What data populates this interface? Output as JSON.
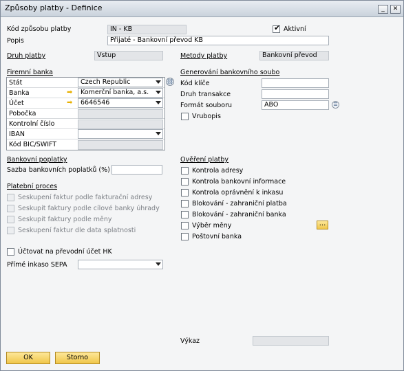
{
  "window": {
    "title": "Způsoby platby - Definice",
    "minimize": "_",
    "restore": "□",
    "close": "✕"
  },
  "header": {
    "code_label": "Kód způsobu platby",
    "code_value": "IN - KB",
    "active_label": "Aktivní",
    "active_checked": true,
    "desc_label": "Popis",
    "desc_value": "Přijaté - Bankovní převod KB"
  },
  "left": {
    "payment_type_label": "Druh platby",
    "payment_type_value": "Vstup",
    "company_bank_section": "Firemní banka",
    "grid": [
      {
        "label": "Stát",
        "value": "Czech Republic",
        "kind": "combo"
      },
      {
        "label": "Banka",
        "value": "Komerční banka, a.s.",
        "kind": "combo",
        "arrow": true
      },
      {
        "label": "Účet",
        "value": "6646546",
        "kind": "combo",
        "arrow": true
      },
      {
        "label": "Pobočka",
        "value": "",
        "kind": "ro"
      },
      {
        "label": "Kontrolní číslo",
        "value": "",
        "kind": "ro"
      },
      {
        "label": "IBAN",
        "value": "",
        "kind": "combo"
      },
      {
        "label": "Kód BIC/SWIFT",
        "value": "",
        "kind": "ro"
      }
    ],
    "bank_fees_section": "Bankovní poplatky",
    "bank_fee_rate_label": "Sazba bankovních poplatků (%)",
    "bank_fee_rate_value": "",
    "payment_process_section": "Platební proces",
    "process_options": [
      "Seskupení faktur podle fakturační adresy",
      "Seskupit faktury podle cílové banky úhrady",
      "Seskupit faktury podle měny",
      "Seskupení faktur dle data splatnosti"
    ],
    "transfer_account_label": "Účtovat na převodní účet HK",
    "sepa_label": "Přímé inkaso SEPA",
    "sepa_value": ""
  },
  "right": {
    "methods_label": "Metody platby",
    "methods_value": "Bankovní převod",
    "file_gen_section": "Generování bankovního soubo",
    "key_code_label": "Kód klíče",
    "key_code_value": "",
    "transaction_type_label": "Druh transakce",
    "transaction_type_value": "",
    "file_format_label": "Formát souboru",
    "file_format_value": "ABO",
    "gross_label": "Vrubopis",
    "verification_section": "Ověření platby",
    "verifications": [
      "Kontrola adresy",
      "Kontrola bankovní informace",
      "Kontrola oprávnění k inkasu",
      "Blokování - zahraniční platba",
      "Blokování - zahraniční banka",
      "Výběr měny",
      "Poštovní banka"
    ],
    "ellipsis": "...",
    "report_label": "Výkaz",
    "report_value": ""
  },
  "footer": {
    "ok": "OK",
    "cancel": "Storno"
  },
  "colors": {
    "accent": "#f0c64a",
    "arrow": "#e8b000"
  },
  "icons": {
    "linked": "link-icon",
    "list": "list-icon",
    "yellow": "yellow-arrow-icon"
  }
}
